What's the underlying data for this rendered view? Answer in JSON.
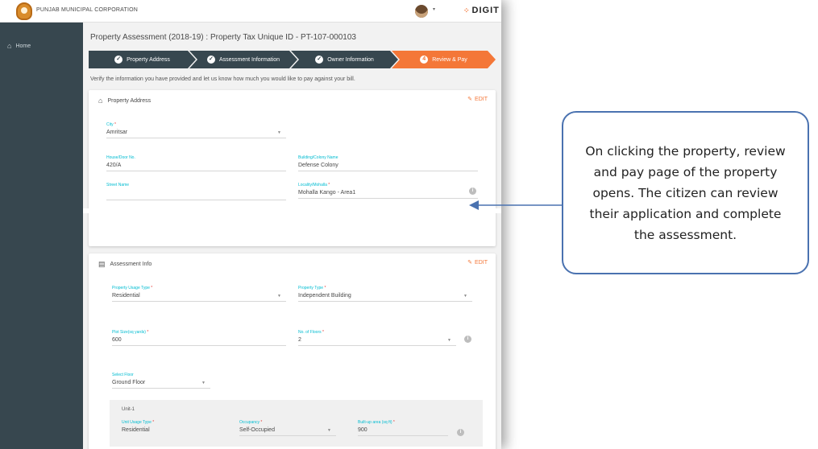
{
  "header": {
    "org_name": "PUNJAB MUNICIPAL CORPORATION",
    "avatar_caret": "▾",
    "brand": "DIGIT"
  },
  "sidebar": {
    "items": [
      {
        "label": "Home",
        "icon": "home-icon"
      }
    ]
  },
  "page": {
    "title": "Property Assessment (2018-19) : Property Tax Unique ID - PT-107-000103",
    "instruction": "Verify the information you have provided and let us know how much you would like to pay against your bill."
  },
  "stepper": {
    "steps": [
      {
        "label": "Property Address",
        "status": "done"
      },
      {
        "label": "Assessment Information",
        "status": "done"
      },
      {
        "label": "Owner Information",
        "status": "done"
      },
      {
        "label": "Review & Pay",
        "status": "active",
        "number": "4"
      }
    ]
  },
  "colors": {
    "accent": "#f47738",
    "sidebar": "#37474f",
    "label": "#00bcd1",
    "callout_border": "#4a72b0"
  },
  "property_address": {
    "heading": "Property Address",
    "edit_label": "EDIT",
    "city": {
      "label": "City",
      "value": "Amritsar"
    },
    "door_no": {
      "label": "House/Door No.",
      "value": "420/A"
    },
    "building": {
      "label": "Building/Colony Name",
      "value": "Defense Colony"
    },
    "street": {
      "label": "Street Name",
      "value": ""
    },
    "locality": {
      "label": "Locality/Mohalla",
      "value": "Mohalla Kango - Area1"
    }
  },
  "assessment_info": {
    "heading": "Assessment Info",
    "edit_label": "EDIT",
    "usage_type": {
      "label": "Property Usage Type",
      "value": "Residential"
    },
    "property_type": {
      "label": "Property Type",
      "value": "Independent Building"
    },
    "plot_size": {
      "label": "Plot Size(sq yards)",
      "value": "600"
    },
    "floors": {
      "label": "No. of Floors",
      "value": "2"
    },
    "select_floor": {
      "label": "Select Floor",
      "value": "Ground Floor"
    },
    "unit": {
      "title": "Unit-1",
      "usage_type": {
        "label": "Unit Usage Type",
        "value": "Residential"
      },
      "occupancy": {
        "label": "Occupancy",
        "value": "Self-Occupied"
      },
      "built_up": {
        "label": "Built-up area (sq ft)",
        "value": "900"
      }
    }
  },
  "required_mark": "*",
  "callout": {
    "text": "On clicking the property, review and pay page of the property opens. The citizen can review their application and complete the assessment."
  }
}
